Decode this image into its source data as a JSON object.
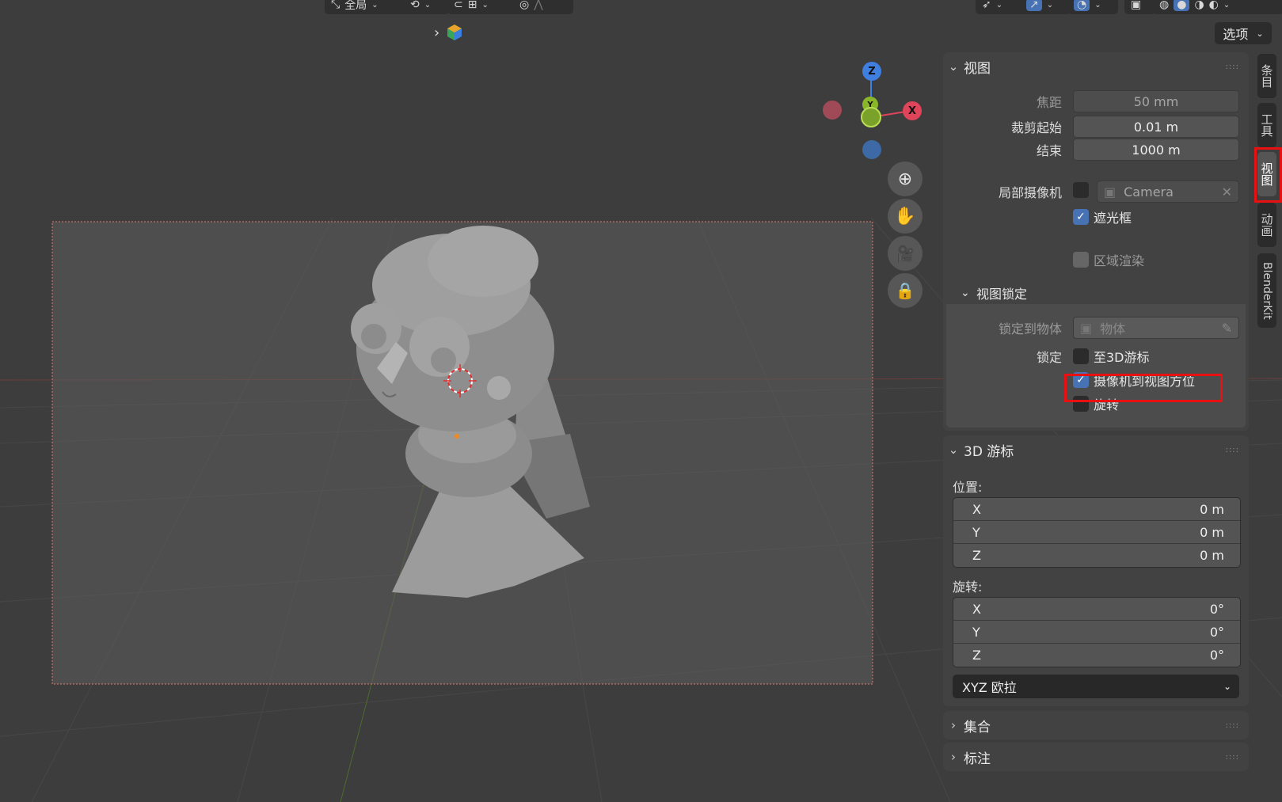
{
  "header": {
    "transform_orientation": "全局",
    "icons": [
      "move-orientation-icon",
      "pivot-icon",
      "snap-icon",
      "snap-increment-icon",
      "proportional-edit-icon",
      "falloff-icon",
      "visibility-icon",
      "gizmo-icon",
      "overlay-icon",
      "xray-icon",
      "wireframe-shading-icon",
      "solid-shading-icon",
      "material-shading-icon",
      "rendered-shading-icon"
    ],
    "options_label": "选项"
  },
  "gizmo": {
    "z": "Z",
    "x": "X",
    "y": "Y"
  },
  "view_panel": {
    "title": "视图",
    "focal_label": "焦距",
    "focal_value": "50 mm",
    "clip_start_label": "裁剪起始",
    "clip_start_value": "0.01 m",
    "clip_end_label": "结束",
    "clip_end_value": "1000 m",
    "local_camera_label": "局部摄像机",
    "local_camera_value": "Camera",
    "passepartout_label": "遮光框",
    "passepartout_checked": true,
    "region_render_label": "区域渲染",
    "view_lock_title": "视图锁定",
    "lock_to_object_label": "锁定到物体",
    "lock_to_object_placeholder": "物体",
    "lock_label": "锁定",
    "lock_3d_cursor_label": "至3D游标",
    "lock_camera_to_view_label": "摄像机到视图方位",
    "lock_camera_to_view_checked": true,
    "lock_rotation_label": "旋转"
  },
  "cursor_panel": {
    "title": "3D 游标",
    "location_label": "位置:",
    "location": [
      {
        "axis": "X",
        "value": "0 m"
      },
      {
        "axis": "Y",
        "value": "0 m"
      },
      {
        "axis": "Z",
        "value": "0 m"
      }
    ],
    "rotation_label": "旋转:",
    "rotation": [
      {
        "axis": "X",
        "value": "0°"
      },
      {
        "axis": "Y",
        "value": "0°"
      },
      {
        "axis": "Z",
        "value": "0°"
      }
    ],
    "rotation_mode": "XYZ 欧拉"
  },
  "collections_panel": {
    "title": "集合"
  },
  "annotations_panel": {
    "title": "标注"
  },
  "side_tabs": [
    {
      "label": "条目",
      "active": false
    },
    {
      "label": "工具",
      "active": false
    },
    {
      "label": "视图",
      "active": true
    },
    {
      "label": "动画",
      "active": false
    },
    {
      "label": "BlenderKit",
      "active": false
    }
  ],
  "colors": {
    "accent": "#4772b3",
    "highlight": "#e81010",
    "axis_x": "#e0445a",
    "axis_y": "#8ab62a",
    "axis_z": "#3f7fe0"
  }
}
